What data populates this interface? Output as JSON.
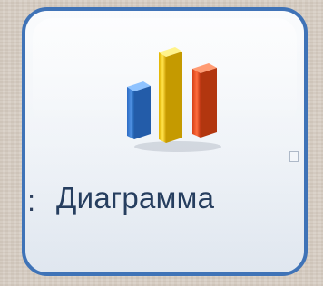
{
  "ribbon": {
    "partial_prefix": ":",
    "button_label": "Диаграмма",
    "icon": "chart-icon",
    "accent_color": "#3f73b7"
  }
}
